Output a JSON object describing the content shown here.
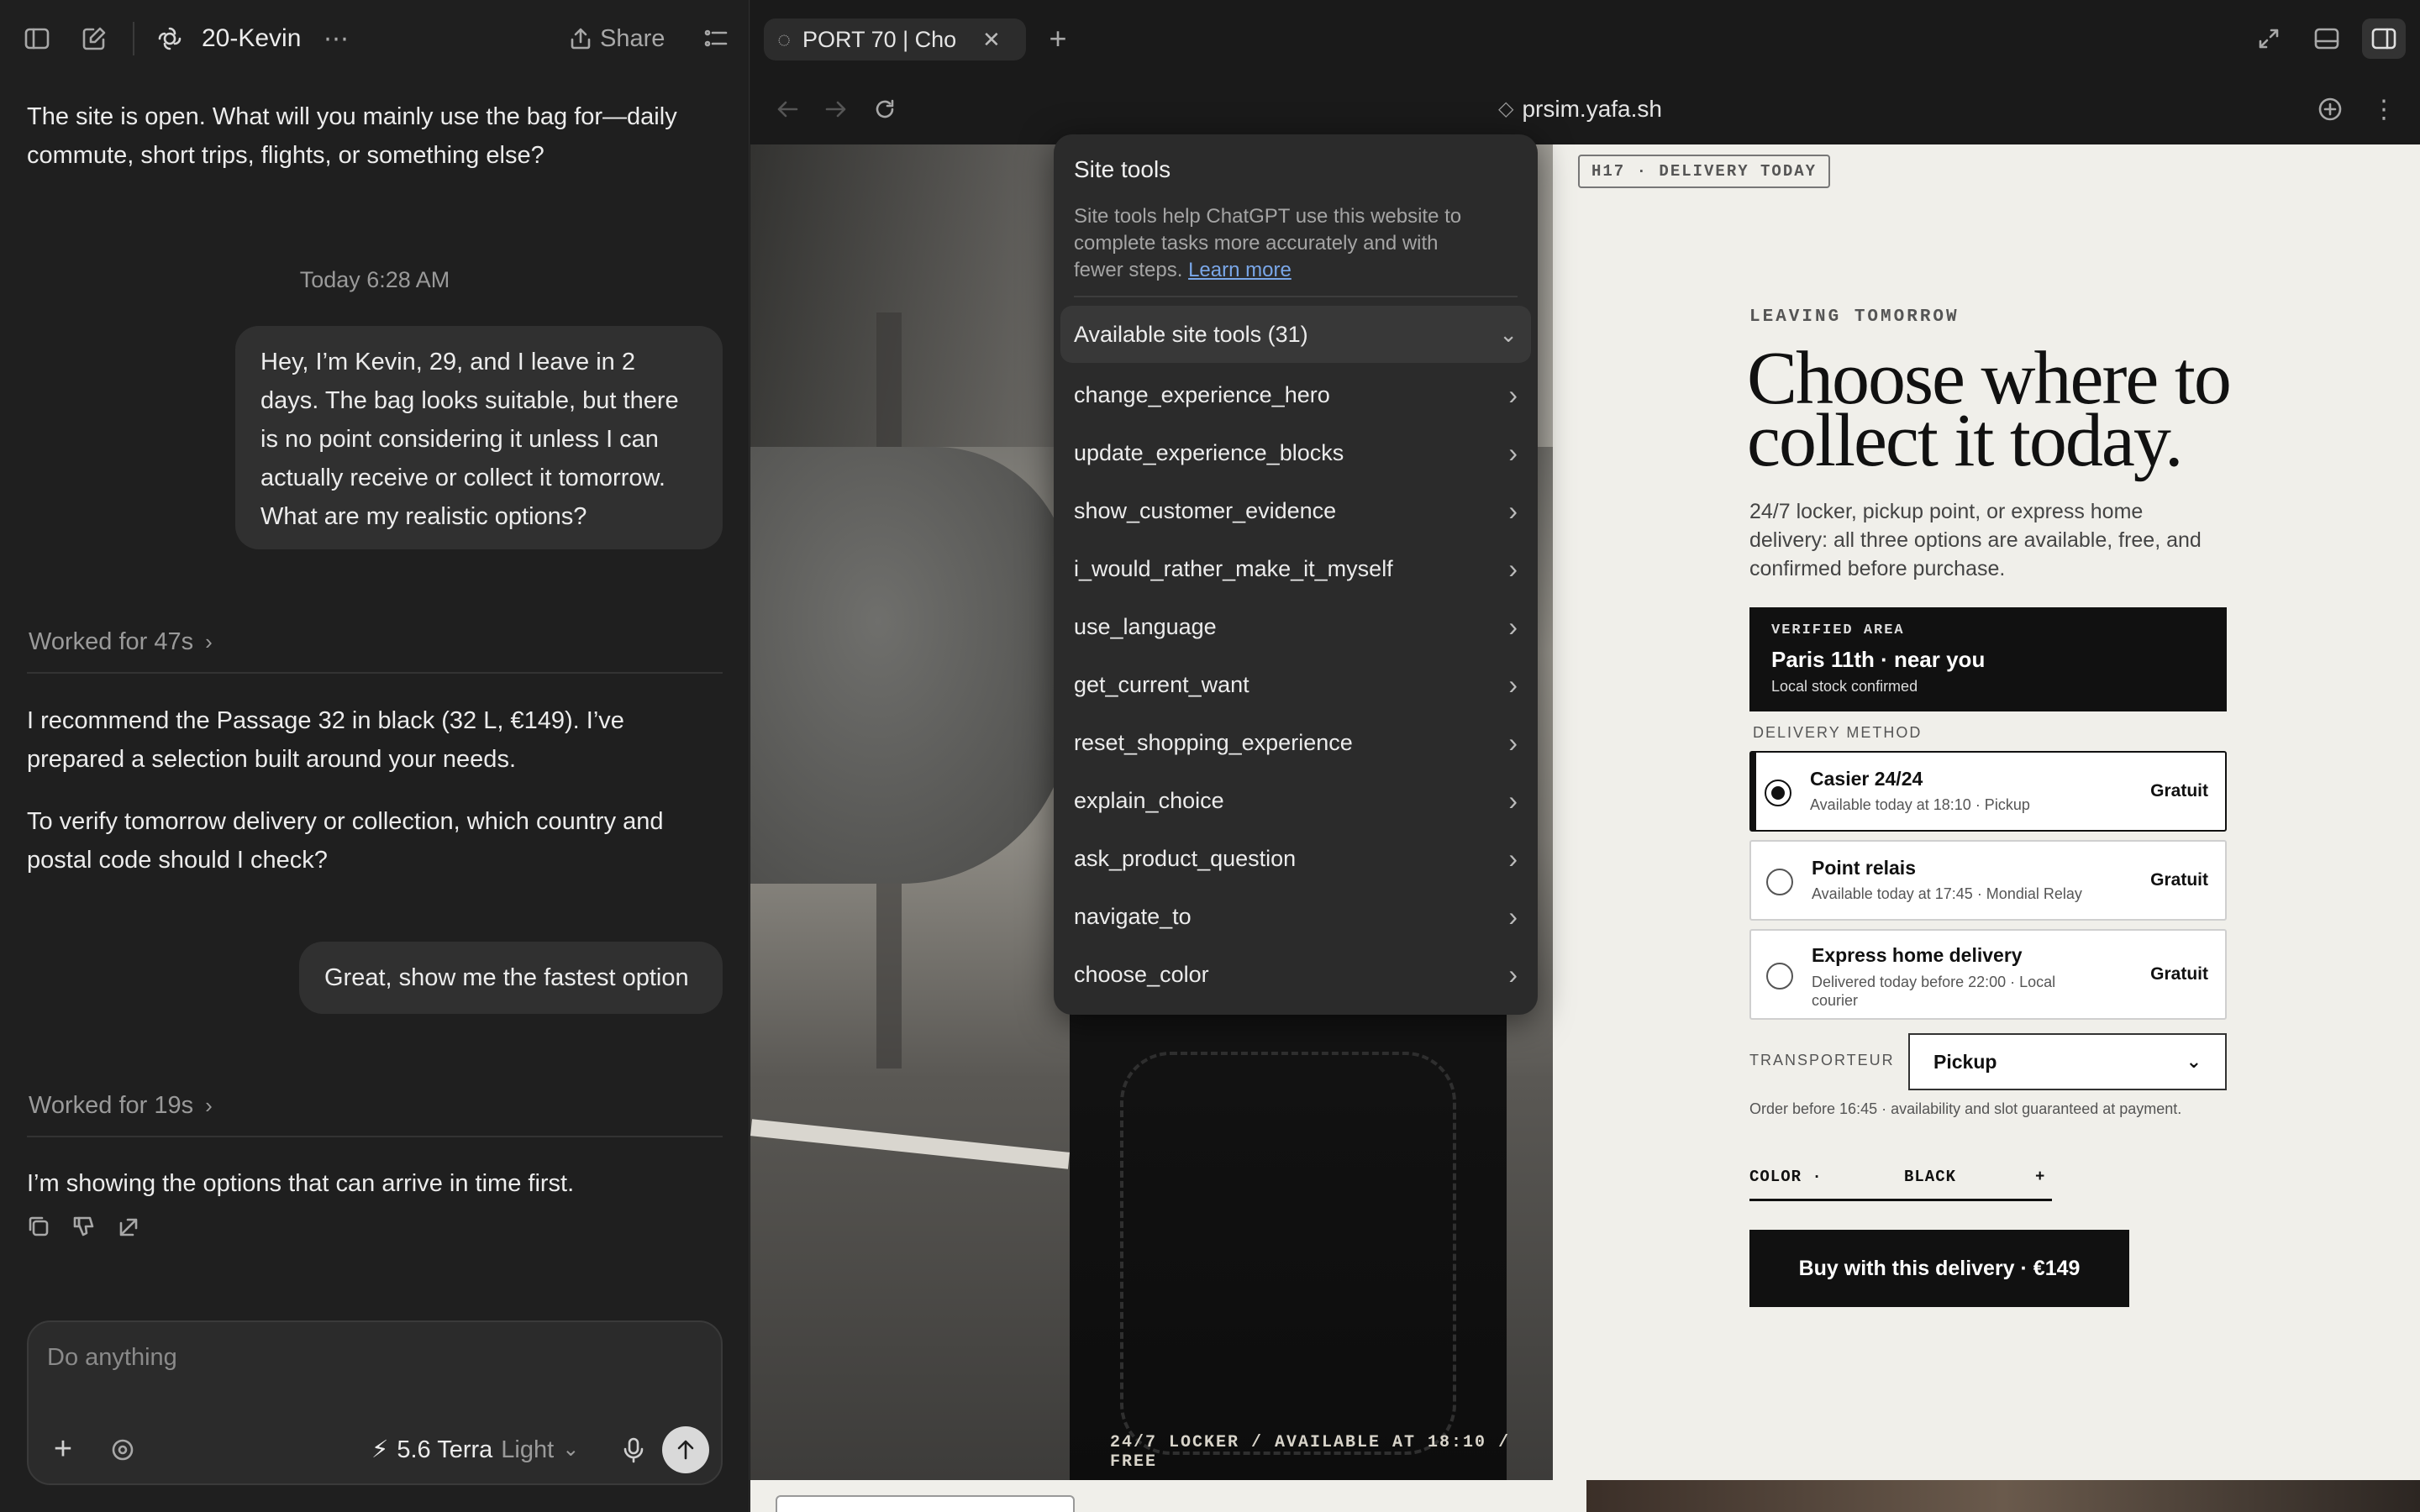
{
  "chat": {
    "title": "20-Kevin",
    "share_label": "Share",
    "msg1": [
      "The site is open. What will you mainly use the bag for—daily",
      "commute, short trips, flights, or something else?"
    ],
    "timestamp": "Today 6:28 AM",
    "user1": [
      "Hey, I’m Kevin, 29, and I leave in 2",
      "days. The bag looks suitable, but there",
      "is no point considering it unless I can",
      "actually receive or collect it tomorrow.",
      "What are my realistic options?"
    ],
    "worked1": "Worked for 47s",
    "msg2a": [
      "I recommend the Passage 32 in black (32 L, €149). I’ve",
      "prepared a selection built around your needs."
    ],
    "msg2b": [
      "To verify tomorrow delivery or collection, which country and",
      "postal code should I check?"
    ],
    "user2": "Great, show me the fastest option",
    "worked2": "Worked for 19s",
    "msg3": "I’m showing the options that can arrive in time first.",
    "composer": {
      "placeholder": "Do anything",
      "model": "5.6 Terra",
      "mode": "Light"
    }
  },
  "browser": {
    "tab_title": "PORT 70 | Cho",
    "url": "prsim.yafa.sh"
  },
  "site_tools": {
    "title": "Site tools",
    "description": [
      "Site tools help ChatGPT use this website to",
      "complete tasks more accurately and with",
      "fewer steps."
    ],
    "learn_more": "Learn more",
    "available": "Available site tools (31)",
    "items": [
      "change_experience_hero",
      "update_experience_blocks",
      "show_customer_evidence",
      "i_would_rather_make_it_myself",
      "use_language",
      "get_current_want",
      "reset_shopping_experience",
      "explain_choice",
      "ask_product_question",
      "navigate_to",
      "choose_color"
    ]
  },
  "page": {
    "badge": "H17 · DELIVERY TODAY",
    "kicker": "LEAVING TOMORROW",
    "headline": [
      "Choose where to",
      "collect it today."
    ],
    "sub": [
      "24/7 locker, pickup point, or express home",
      "delivery: all three options are available, free, and",
      "confirmed before purchase."
    ],
    "verified": {
      "label": "VERIFIED AREA",
      "area": "Paris 11th · near you",
      "note": "Local stock confirmed"
    },
    "delivery_method_label": "DELIVERY METHOD",
    "options": [
      {
        "name": "Casier 24/24",
        "detail": "Available today at 18:10 · Pickup",
        "price": "Gratuit",
        "selected": true
      },
      {
        "name": "Point relais",
        "detail": "Available today at 17:45 · Mondial Relay",
        "price": "Gratuit",
        "selected": false
      },
      {
        "name": "Express home delivery",
        "detail": [
          "Delivered today before 22:00 · Local",
          "courier"
        ],
        "price": "Gratuit",
        "selected": false
      }
    ],
    "carrier_label": "TRANSPORTEUR",
    "carrier_value": "Pickup",
    "order_note": "Order before 16:45 · availability and slot guaranteed at payment.",
    "color_label": "COLOR ·",
    "color_value": "BLACK",
    "color_plus": "+",
    "buy_label": "Buy with this delivery · €149",
    "photo_caption": "24/7 LOCKER / AVAILABLE AT 18:10 / FREE"
  }
}
